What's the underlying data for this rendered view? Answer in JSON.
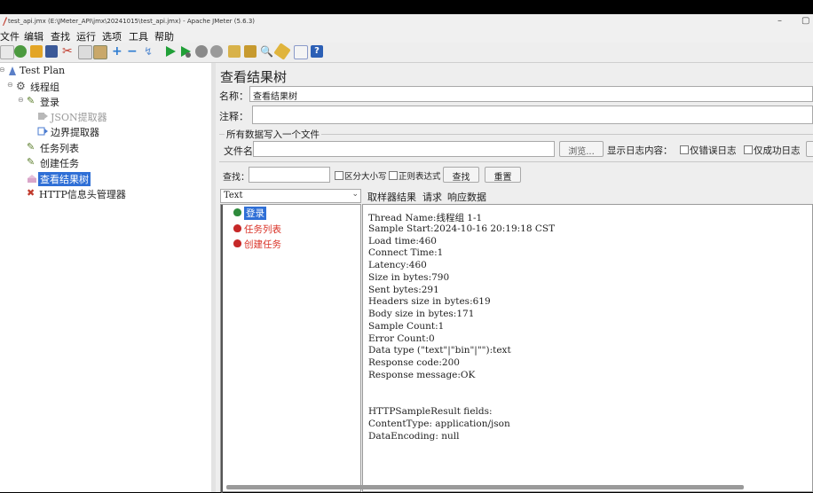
{
  "window": {
    "title": "test_api.jmx (E:\\JMeter_API\\jmx\\20241015\\test_api.jmx) - Apache JMeter (5.6.3)",
    "minimize": "–",
    "maximize": "▢"
  },
  "menu": [
    "文件",
    "编辑",
    "查找",
    "运行",
    "选项",
    "工具",
    "帮助"
  ],
  "toolbar_icons": [
    "new-icon",
    "templates-icon",
    "open-icon",
    "save-icon",
    "cut-icon",
    "copy-icon",
    "paste-icon",
    "expand-icon",
    "collapse-icon",
    "toggle-icon",
    "start-icon",
    "start-no-pause-icon",
    "stop-icon",
    "shutdown-icon",
    "clear-icon",
    "clear-all-icon",
    "search-icon",
    "reset-search-icon",
    "function-helper-icon",
    "help-icon"
  ],
  "tree": [
    {
      "label": "Test Plan",
      "level": 0,
      "icon": "test-plan-icon",
      "color": "#222222",
      "selected": false
    },
    {
      "label": "线程组",
      "level": 1,
      "icon": "gear-icon",
      "color": "#222222",
      "selected": false
    },
    {
      "label": "登录",
      "level": 2,
      "icon": "sampler-icon",
      "color": "#222222",
      "selected": false
    },
    {
      "label": "JSON提取器",
      "level": 3,
      "icon": "extractor-icon",
      "color": "#9a9a9a",
      "selected": false
    },
    {
      "label": "边界提取器",
      "level": 3,
      "icon": "extractor-icon",
      "color": "#222222",
      "selected": false
    },
    {
      "label": "任务列表",
      "level": 1.6,
      "icon": "sampler-icon",
      "color": "#222222",
      "selected": false
    },
    {
      "label": "创建任务",
      "level": 1.6,
      "icon": "sampler-icon",
      "color": "#222222",
      "selected": false
    },
    {
      "label": "查看结果树",
      "level": 1.6,
      "icon": "listener-icon",
      "color": "#ffffff",
      "selected": true
    },
    {
      "label": "HTTP信息头管理器",
      "level": 1.2,
      "icon": "config-icon",
      "color": "#222222",
      "selected": false
    }
  ],
  "panel": {
    "title": "查看结果树",
    "name_label": "名称：",
    "name_value": "查看结果树",
    "comment_label": "注释：",
    "comment_value": "",
    "file_section": "所有数据写入一个文件",
    "filename_label": "文件名",
    "filename_value": "",
    "browse": "浏览...",
    "log_label": "显示日志内容：",
    "errors_only": "仅错误日志",
    "success_only": "仅成功日志",
    "search_label": "查找：",
    "search_value": "",
    "case_sensitive": "区分大小写",
    "regex": "正则表达式",
    "find_button": "查找",
    "reset_button": "重置",
    "renderer": "Text",
    "tabs": [
      "取样器结果",
      "请求",
      "响应数据"
    ]
  },
  "results": [
    {
      "label": "登录",
      "status": "success",
      "color": "#ffffff"
    },
    {
      "label": "任务列表",
      "status": "error",
      "color": "#d93025"
    },
    {
      "label": "创建任务",
      "status": "error",
      "color": "#d93025"
    }
  ],
  "detail_lines": [
    "Thread Name:线程组 1-1",
    "Sample Start:2024-10-16 20:19:18 CST",
    "Load time:460",
    "Connect Time:1",
    "Latency:460",
    "Size in bytes:790",
    "Sent bytes:291",
    "Headers size in bytes:619",
    "Body size in bytes:171",
    "Sample Count:1",
    "Error Count:0",
    "Data type (\"text\"|\"bin\"|\"\"):text",
    "Response code:200",
    "Response message:OK",
    "",
    "",
    "HTTPSampleResult fields:",
    "ContentType: application/json",
    "DataEncoding: null"
  ]
}
